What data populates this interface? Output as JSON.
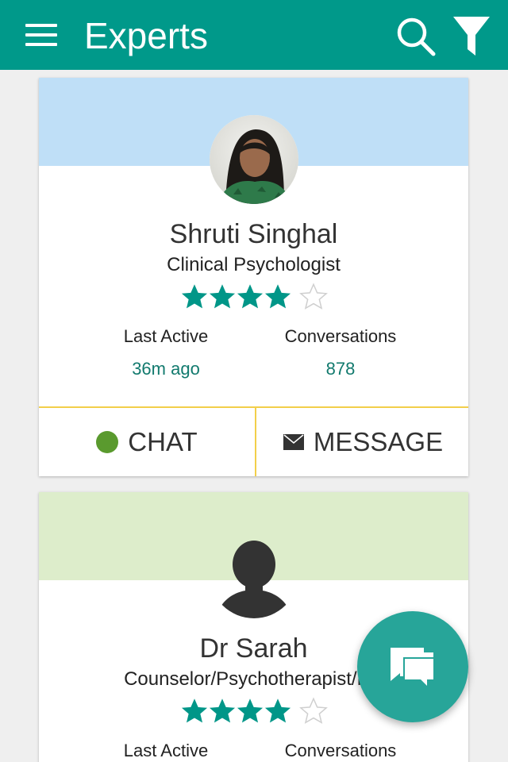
{
  "app_bar": {
    "title": "Experts",
    "menu_icon": "menu-icon",
    "search_icon": "search-icon",
    "filter_icon": "filter-icon",
    "color": "#00998a"
  },
  "experts": [
    {
      "name": "Shruti Singhal",
      "title": "Clinical Psychologist",
      "rating": 4,
      "max_rating": 5,
      "last_active_label": "Last Active",
      "last_active": "36m ago",
      "conversations_label": "Conversations",
      "conversations": "878",
      "online": true,
      "chat_label": "CHAT",
      "message_label": "MESSAGE",
      "banner_color": "#bfdff7"
    },
    {
      "name": "Dr Sarah",
      "title": "Counselor/Psychotherapist/Me",
      "rating": 4,
      "max_rating": 5,
      "last_active_label": "Last Active",
      "conversations_label": "Conversations",
      "banner_color": "#ddedcb"
    }
  ],
  "fab": {
    "icon": "chat-bubbles-icon",
    "color": "#27a599"
  },
  "colors": {
    "accent_text": "#127a6e",
    "star": "#009688",
    "divider": "#f2cf4a",
    "online": "#5a9a2e"
  }
}
